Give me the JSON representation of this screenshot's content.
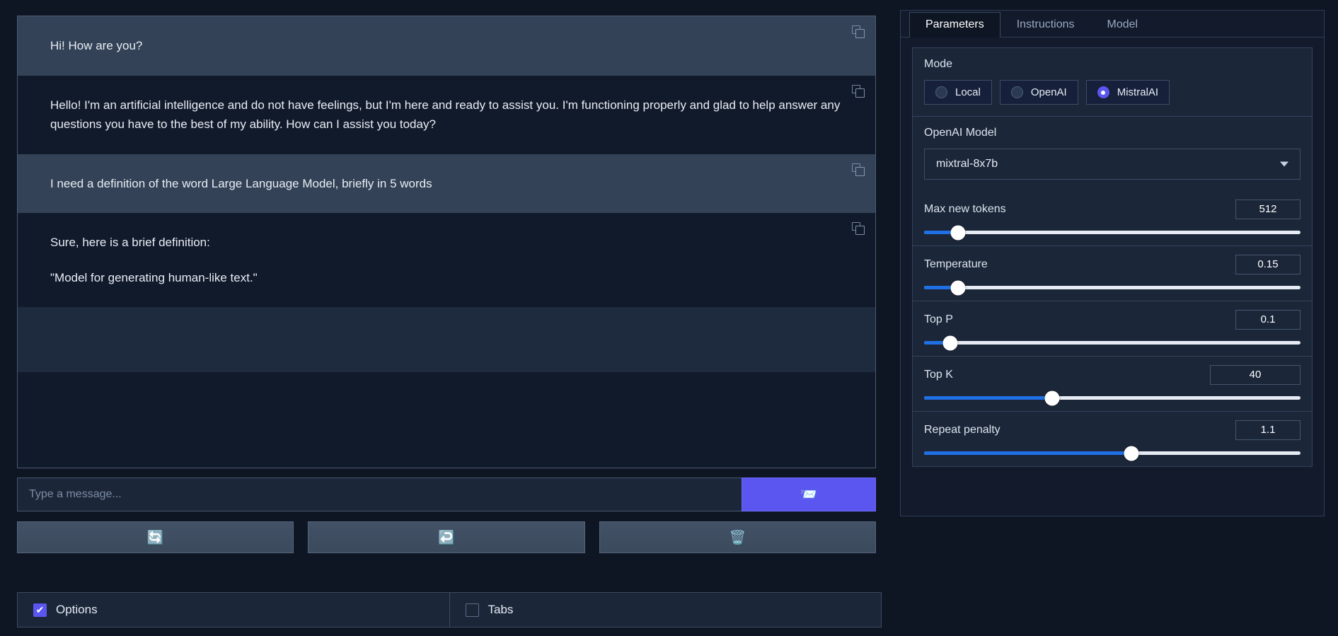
{
  "chat": {
    "messages": [
      {
        "role": "user",
        "text": "Hi! How are you?",
        "copy_icon": "copy-icon"
      },
      {
        "role": "bot",
        "text": "Hello! I'm an artificial intelligence and do not have feelings, but I'm here and ready to assist you. I'm functioning properly and glad to help answer any questions you have to the best of my ability. How can I assist you today?",
        "copy_icon": "copy-icon"
      },
      {
        "role": "user",
        "text": "I need a definition of the word Large Language Model, briefly in 5 words",
        "copy_icon": "copy-icon"
      },
      {
        "role": "bot",
        "text": "Sure, here is a brief definition:",
        "text2": "\"Model for generating human-like text.\"",
        "copy_icon": "copy-icon"
      }
    ]
  },
  "composer": {
    "placeholder": "Type a message...",
    "value": "",
    "send_icon": "📨",
    "send_icon_name": "send-envelope-icon"
  },
  "actions": [
    {
      "label": "🔄",
      "name": "regenerate-button"
    },
    {
      "label": "↩️",
      "name": "undo-button"
    },
    {
      "label": "🗑️",
      "name": "clear-button"
    }
  ],
  "bottom_checks": [
    {
      "label": "Options",
      "checked": true,
      "mark": "✔"
    },
    {
      "label": "Tabs",
      "checked": false,
      "mark": ""
    }
  ],
  "tabs": [
    {
      "label": "Parameters",
      "active": true
    },
    {
      "label": "Instructions",
      "active": false
    },
    {
      "label": "Model",
      "active": false
    }
  ],
  "parameters": {
    "mode": {
      "label": "Mode",
      "options": [
        {
          "label": "Local",
          "selected": false
        },
        {
          "label": "OpenAI",
          "selected": false
        },
        {
          "label": "MistralAI",
          "selected": true
        }
      ]
    },
    "model": {
      "label": "OpenAI Model",
      "value": "mixtral-8x7b"
    },
    "sliders": [
      {
        "name": "Max new tokens",
        "value": "512",
        "fill_pct": 9,
        "wide": false
      },
      {
        "name": "Temperature",
        "value": "0.15",
        "fill_pct": 9,
        "wide": false
      },
      {
        "name": "Top P",
        "value": "0.1",
        "fill_pct": 7,
        "wide": false
      },
      {
        "name": "Top K",
        "value": "40",
        "fill_pct": 34,
        "wide": true
      },
      {
        "name": "Repeat penalty",
        "value": "1.1",
        "fill_pct": 55,
        "wide": false
      }
    ]
  },
  "colors": {
    "accent_purple": "#5b56f0",
    "slider_blue": "#1f6fe5",
    "bg": "#0e1523",
    "panel": "#1b2639",
    "user_bubble": "#334257"
  }
}
